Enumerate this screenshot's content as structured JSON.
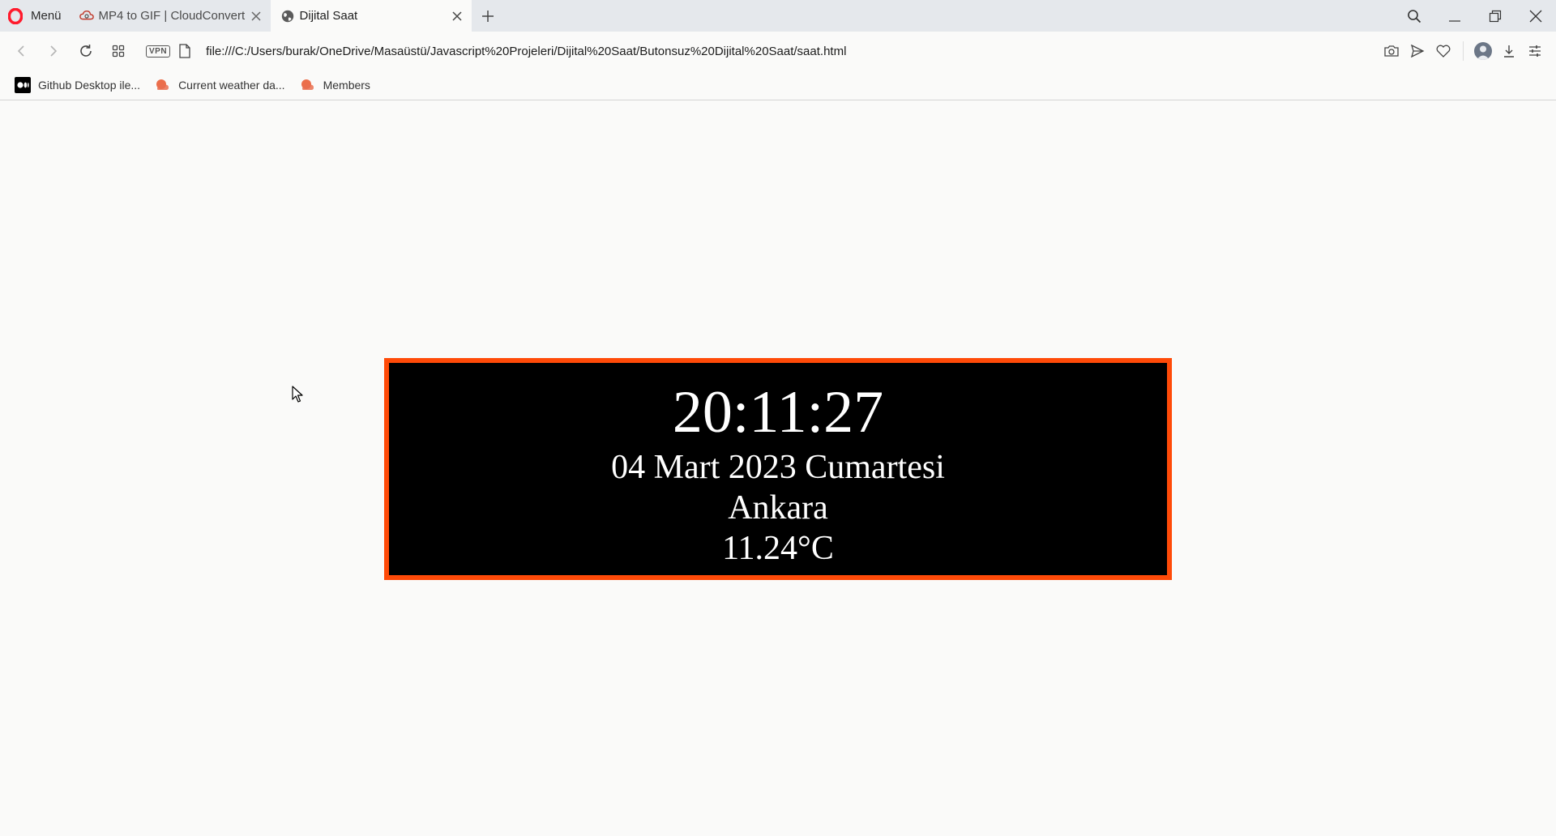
{
  "browser": {
    "menu_label": "Menü",
    "tabs": [
      {
        "label": "MP4 to GIF | CloudConvert",
        "active": false
      },
      {
        "label": "Dijital Saat",
        "active": true
      }
    ],
    "url": "file:///C:/Users/burak/OneDrive/Masaüstü/Javascript%20Projeleri/Dijital%20Saat/Butonsuz%20Dijital%20Saat/saat.html",
    "vpn_label": "VPN",
    "bookmarks": [
      {
        "label": "Github Desktop ile..."
      },
      {
        "label": "Current weather da..."
      },
      {
        "label": "Members"
      }
    ],
    "colors": {
      "opera_red": "#ff1b2d",
      "clock_border": "#ff4a08",
      "clock_bg": "#000000",
      "clock_text": "#ffffff",
      "page_bg": "#fafaf9"
    }
  },
  "clock": {
    "time": "20:11:27",
    "date": "04 Mart 2023 Cumartesi",
    "city": "Ankara",
    "temperature": "11.24°C"
  }
}
